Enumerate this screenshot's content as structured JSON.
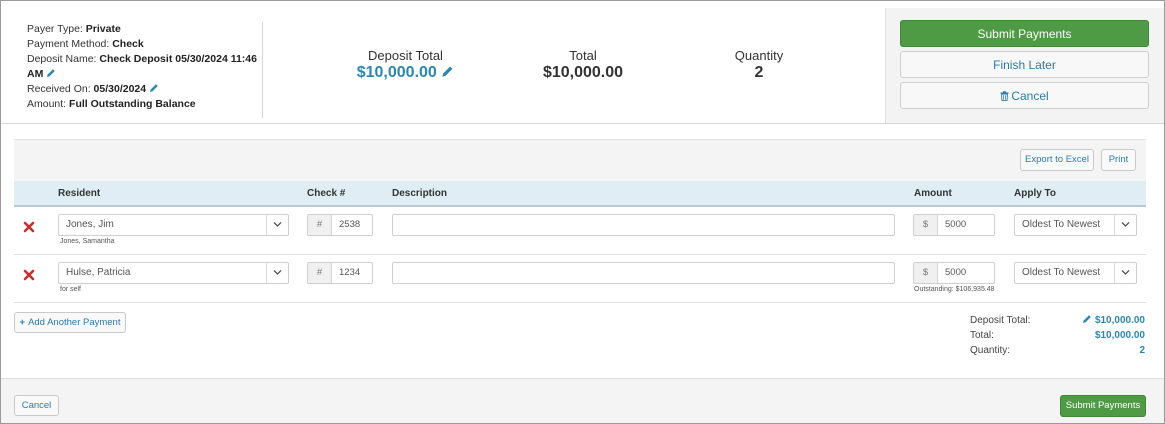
{
  "info": {
    "payer_type_label": "Payer Type:",
    "payer_type_value": "Private",
    "payment_method_label": "Payment Method:",
    "payment_method_value": "Check",
    "deposit_name_label": "Deposit Name:",
    "deposit_name_value_line1": "Check Deposit 05/30/2024 11:46",
    "deposit_name_value_line2": "AM",
    "received_on_label": "Received On:",
    "received_on_value": "05/30/2024",
    "amount_label": "Amount:",
    "amount_value": "Full Outstanding Balance"
  },
  "stats": {
    "deposit_total_label": "Deposit Total",
    "deposit_total_value": "$10,000.00",
    "total_label": "Total",
    "total_value": "$10,000.00",
    "quantity_label": "Quantity",
    "quantity_value": "2"
  },
  "actions": {
    "submit": "Submit Payments",
    "finish_later": "Finish Later",
    "cancel": "Cancel"
  },
  "toolbar": {
    "export": "Export to Excel",
    "print": "Print"
  },
  "table": {
    "headers": {
      "resident": "Resident",
      "check": "Check #",
      "description": "Description",
      "amount": "Amount",
      "apply_to": "Apply To"
    },
    "rows": [
      {
        "resident": "Jones, Jim",
        "sub": "Jones, Samantha",
        "check_prefix": "#",
        "check": "2538",
        "description": "",
        "amount_prefix": "$",
        "amount": "5000",
        "outstanding": "",
        "apply_to": "Oldest To Newest"
      },
      {
        "resident": "Hulse, Patricia",
        "sub": "for self",
        "check_prefix": "#",
        "check": "1234",
        "description": "",
        "amount_prefix": "$",
        "amount": "5000",
        "outstanding": "Outstanding: $106,935.48",
        "apply_to": "Oldest To Newest"
      }
    ]
  },
  "add_payment": "Add Another Payment",
  "totals": {
    "deposit_total_label": "Deposit Total:",
    "deposit_total_value": "$10,000.00",
    "total_label": "Total:",
    "total_value": "$10,000.00",
    "quantity_label": "Quantity:",
    "quantity_value": "2"
  },
  "footer": {
    "cancel": "Cancel",
    "submit": "Submit Payments"
  },
  "colors": {
    "accent_blue": "#2a87b3",
    "submit_green": "#4e9a45",
    "delete_red": "#c9302c",
    "header_bg": "#dfeef5"
  },
  "icons": {
    "edit": "pencil-icon",
    "trash": "trash-icon",
    "delete": "delete-x-icon",
    "dropdown": "chevron-down-icon",
    "add": "plus-icon"
  }
}
